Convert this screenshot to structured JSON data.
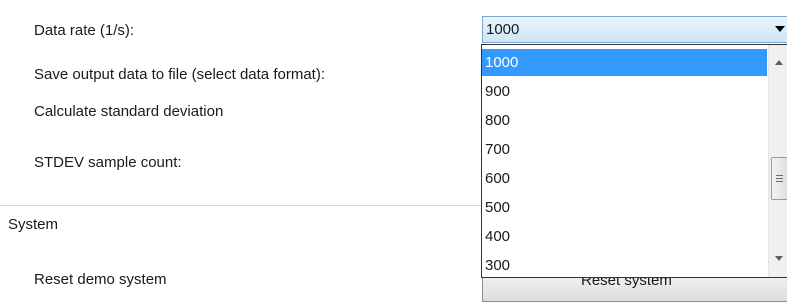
{
  "settings": {
    "data_rate_label": "Data rate (1/s):",
    "save_output_label": "Save output data to file (select data format):",
    "std_dev_label": "Calculate standard deviation",
    "stdev_count_label": "STDEV sample count:"
  },
  "system": {
    "group_title": "System",
    "reset_demo_label": "Reset demo system",
    "reset_button_label": "Reset system"
  },
  "data_rate_combo": {
    "value": "1000",
    "options": [
      "1000",
      "900",
      "800",
      "700",
      "600",
      "500",
      "400",
      "300"
    ],
    "selected_index": 0
  },
  "colors": {
    "selection": "#3399ff",
    "group_line": "#c9dbe9"
  },
  "icons": {
    "combo_arrow": "chevron-down-icon",
    "scroll_up": "scroll-up-arrow-icon",
    "scroll_down": "scroll-down-arrow-icon"
  }
}
